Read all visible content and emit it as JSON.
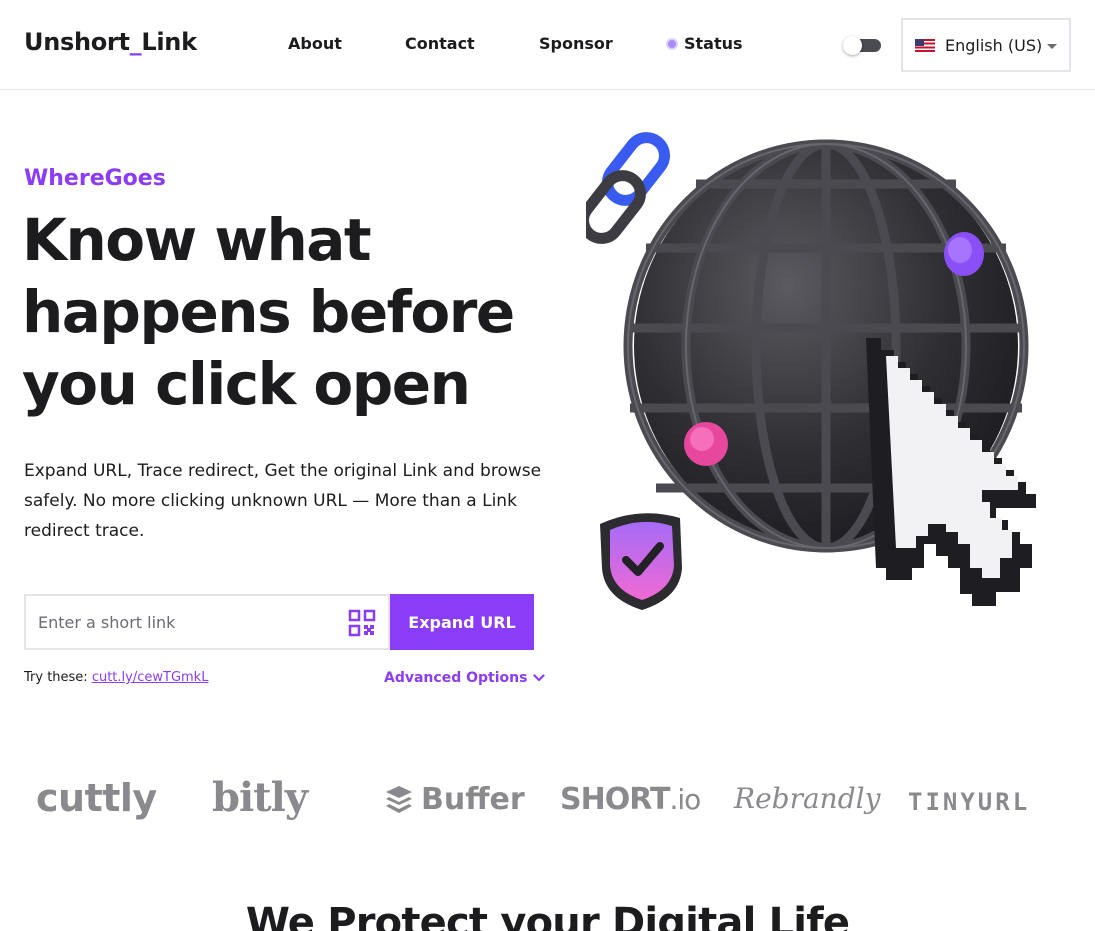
{
  "header": {
    "logo_left": "Unshort",
    "logo_sep": "_",
    "logo_right": "Link",
    "nav": {
      "about": "About",
      "contact": "Contact",
      "sponsor": "Sponsor",
      "status": "Status"
    },
    "language": "English (US)"
  },
  "hero": {
    "eyebrow": "WhereGoes",
    "headline_line1": "Know what",
    "headline_line2": "happens before",
    "headline_line3": "you click open",
    "description": "Expand URL, Trace redirect, Get the original Link and browse safely. No more clicking unknown URL — More than a Link redirect trace.",
    "search_placeholder": "Enter a short link",
    "expand_label": "Expand URL",
    "try_label": "Try these:",
    "try_link": "cutt.ly/cewTGmkL",
    "advanced_label": "Advanced Options"
  },
  "brands": {
    "cuttly": "cuttly",
    "bitly": "bitly",
    "buffer": "Buffer",
    "short_main": "SHORT",
    "short_suffix": ".io",
    "rebrandly": "Rebrandly",
    "tinyurl": "TINYURL"
  },
  "section": {
    "title": "We Protect your Digital Life"
  },
  "colors": {
    "accent": "#8b3cf7",
    "text": "#1c1c1f",
    "brand_gray": "#8a8a8e"
  },
  "icons": {
    "qr": "qr-code-icon",
    "chevron": "chevron-down-icon",
    "flag": "us-flag-icon"
  }
}
